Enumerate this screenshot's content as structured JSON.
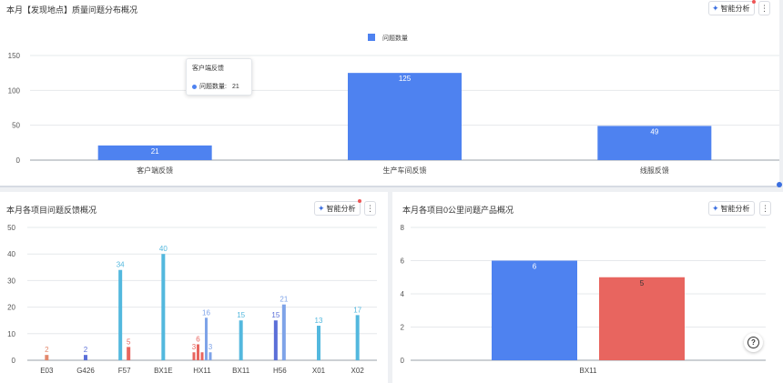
{
  "panels": {
    "top": {
      "title": "本月【发现地点】质量问题分布概况",
      "ai_label": "智能分析",
      "more_label": "⋮"
    },
    "bottom_left": {
      "title": "本月各项目问题反馈概况",
      "ai_label": "智能分析",
      "more_label": "⋮"
    },
    "bottom_right": {
      "title": "本月各项目0公里问题产品概况",
      "ai_label": "智能分析",
      "more_label": "⋮"
    }
  },
  "tooltip": {
    "title": "客户端反馈",
    "label": "问题数量:",
    "value": "21"
  },
  "colors": {
    "blue": "#4e82f0",
    "red": "#e8655f",
    "cyan": "#53b8de",
    "purple": "#5b6fd8",
    "lightblue": "#7ea3e8",
    "orange": "#e3886c"
  },
  "chart_data": [
    {
      "type": "bar",
      "legend": [
        "问题数量"
      ],
      "legend_position": "top-center",
      "categories": [
        "客户端反馈",
        "生产车间反馈",
        "线服反馈"
      ],
      "series": [
        {
          "name": "问题数量",
          "values": [
            21,
            125,
            49
          ]
        }
      ],
      "y_ticks": [
        "0",
        "50",
        "100",
        "150"
      ],
      "ylim": [
        0,
        150
      ],
      "grid": true
    },
    {
      "type": "bar",
      "categories": [
        "E03",
        "G426",
        "F57",
        "BX1E",
        "HX11",
        "BX11",
        "H56",
        "X01",
        "X02"
      ],
      "bars": [
        {
          "category": "E03",
          "value": 2,
          "color": "#e3886c",
          "show_label": true
        },
        {
          "category": "G426",
          "value": 2,
          "color": "#5b6fd8",
          "show_label": true
        },
        {
          "category": "F57",
          "value": 34,
          "color": "#53b8de",
          "show_label": true
        },
        {
          "category": "F57",
          "value": 5,
          "color": "#e8655f",
          "show_label": true
        },
        {
          "category": "BX1E",
          "value": 40,
          "color": "#53b8de",
          "show_label": true
        },
        {
          "category": "HX11",
          "value": 3,
          "color": "#e8655f",
          "show_label": true
        },
        {
          "category": "HX11",
          "value": 6,
          "color": "#e8655f",
          "show_label": true
        },
        {
          "category": "HX11",
          "value": 3,
          "color": "#e8655f",
          "show_label": false
        },
        {
          "category": "HX11",
          "value": 16,
          "color": "#7ea3e8",
          "show_label": true
        },
        {
          "category": "HX11",
          "value": 3,
          "color": "#7ea3e8",
          "show_label": true
        },
        {
          "category": "BX11",
          "value": 15,
          "color": "#53b8de",
          "show_label": true
        },
        {
          "category": "H56",
          "value": 15,
          "color": "#5b6fd8",
          "show_label": true
        },
        {
          "category": "H56",
          "value": 21,
          "color": "#7ea3e8",
          "show_label": true
        },
        {
          "category": "X01",
          "value": 13,
          "color": "#53b8de",
          "show_label": true
        },
        {
          "category": "X02",
          "value": 17,
          "color": "#53b8de",
          "show_label": true
        }
      ],
      "y_ticks": [
        "0",
        "10",
        "20",
        "30",
        "40",
        "50"
      ],
      "ylim": [
        0,
        50
      ],
      "grid": true
    },
    {
      "type": "bar",
      "categories": [
        "BX11"
      ],
      "bars": [
        {
          "category": "BX11",
          "value": 6,
          "color": "#4e82f0",
          "show_label": true
        },
        {
          "category": "BX11",
          "value": 5,
          "color": "#e8655f",
          "show_label": true
        }
      ],
      "y_ticks": [
        "0",
        "2",
        "4",
        "6",
        "8"
      ],
      "ylim": [
        0,
        8
      ],
      "grid": true
    }
  ]
}
